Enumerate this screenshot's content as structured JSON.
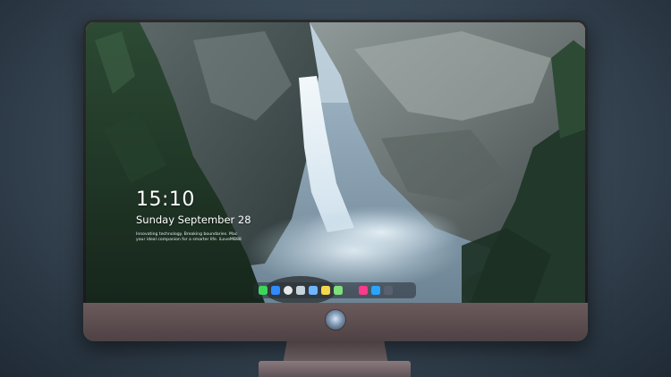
{
  "lock_screen": {
    "time": "15:10",
    "date": "Sunday September 28",
    "note": "Innovating technology. Breaking boundaries. Mac your ideal companion for a smarter life. iLoveMB88"
  },
  "dock": {
    "items": [
      {
        "name": "messages-icon",
        "color": "#3dd65a"
      },
      {
        "name": "files-icon",
        "color": "#2f8bff"
      },
      {
        "name": "clock-icon",
        "color": "#e8e8e8"
      },
      {
        "name": "preview-icon",
        "color": "#c8d4dc"
      },
      {
        "name": "clapper-icon",
        "color": "#6fb6ff"
      },
      {
        "name": "notes-icon",
        "color": "#f6d64a"
      },
      {
        "name": "photos-icon",
        "color": "#7fe07a"
      },
      {
        "name": "music-icon",
        "color": "#fa3a8a"
      },
      {
        "name": "app-store-icon",
        "color": "#2aa5ff"
      },
      {
        "name": "window-icon",
        "color": "#5a6070"
      }
    ]
  },
  "colors": {
    "bezel": "#1f1d1f",
    "chin": "#5d4e50",
    "background": "#3b4a58"
  }
}
